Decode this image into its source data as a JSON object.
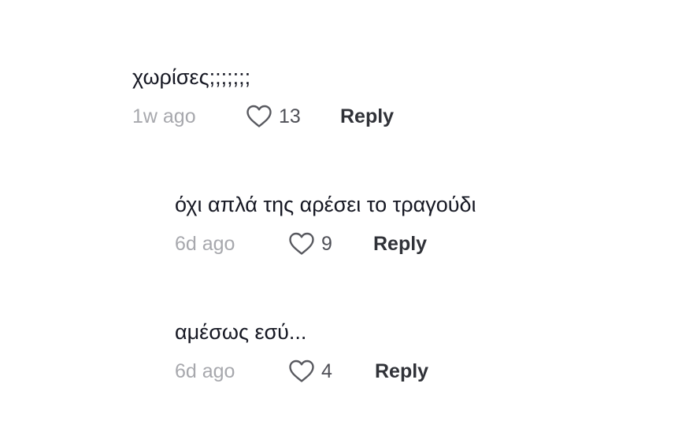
{
  "comments": [
    {
      "text": "χωρίσες;;;;;;;",
      "time": "1w ago",
      "likes": "13",
      "reply_label": "Reply",
      "like_icon": "heart-outline-icon"
    },
    {
      "text": "όχι απλά της αρέσει το τραγούδι",
      "time": "6d ago",
      "likes": "9",
      "reply_label": "Reply",
      "like_icon": "heart-outline-icon"
    },
    {
      "text": "αμέσως εσύ...",
      "time": "6d ago",
      "likes": "4",
      "reply_label": "Reply",
      "like_icon": "heart-outline-icon"
    }
  ],
  "colors": {
    "text": "#161823",
    "timestamp": "#a7a8ad",
    "like_count": "#4f5057",
    "reply": "#303238",
    "icon_stroke": "#58595f"
  }
}
